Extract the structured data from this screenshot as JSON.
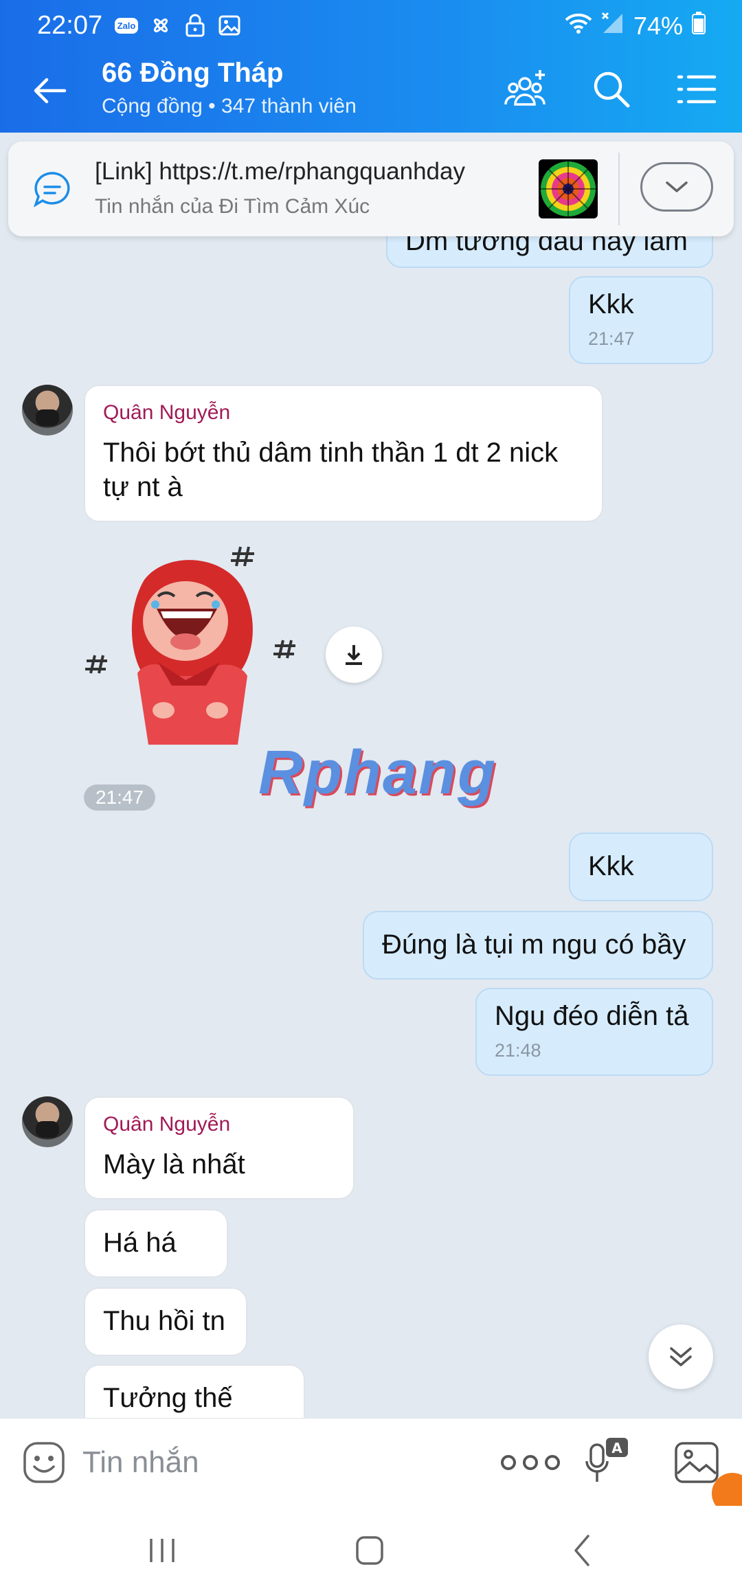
{
  "status": {
    "time": "22:07",
    "zalo_badge": "Zalo",
    "battery": "74%"
  },
  "header": {
    "title": "66 Đồng Tháp",
    "subtitle": "Cộng đồng • 347 thành viên"
  },
  "pinned": {
    "title": "[Link] https://t.me/rphangquanhday",
    "sub": "Tin nhắn của Đi Tìm Cảm Xúc"
  },
  "messages": {
    "m0": "Dm tướng đầu hay lắm",
    "m1": {
      "text": "Kkk",
      "time": "21:47"
    },
    "m2": {
      "sender": "Quân Nguyễn",
      "line1": "Thôi bớt thủ dâm tinh thần 1 dt 2 nick",
      "line2": "tự nt à"
    },
    "sticker_time": "21:47",
    "m3": "Kkk",
    "m4": "Đúng là tụi m ngu có bầy",
    "m5": {
      "text": "Ngu đéo diễn tả",
      "time": "21:48"
    },
    "m6": {
      "sender": "Quân Nguyễn",
      "text": "Mày là nhất"
    },
    "m7": "Há há",
    "m8": "Thu hồi tn",
    "m9": "Tưởng thế nào"
  },
  "watermark": "Rphang",
  "input": {
    "placeholder": "Tin nhắn"
  },
  "colors": {
    "header_start": "#1a6de8",
    "header_end": "#15aaf2",
    "chat_bg": "#e2e9f1",
    "my_bubble": "#d6ecfd",
    "sender_name": "#a11a57"
  },
  "icons": {
    "back": "arrow-left-icon",
    "add_member": "add-member-icon",
    "search": "search-icon",
    "menu": "list-menu-icon",
    "pin": "chat-bubble-icon",
    "expand": "chevron-down-icon",
    "download": "download-icon",
    "scroll": "double-chevron-down-icon",
    "emoji": "emoji-icon",
    "more": "more-dots-icon",
    "voice": "voice-to-text-icon",
    "image": "image-icon"
  }
}
